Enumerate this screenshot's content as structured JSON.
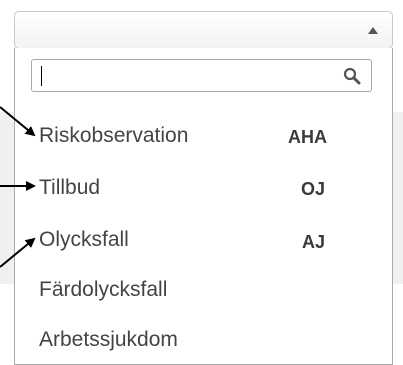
{
  "search": {
    "value": "",
    "placeholder": ""
  },
  "icons": {
    "dropdown_arrow": "triangle-up-icon",
    "search": "search-icon",
    "annotation_arrow": "arrow-icon"
  },
  "options": [
    {
      "label": "Riskobservation",
      "code": "AHA"
    },
    {
      "label": "Tillbud",
      "code": "OJ"
    },
    {
      "label": "Olycksfall",
      "code": "AJ"
    },
    {
      "label": "Färdolycksfall",
      "code": ""
    },
    {
      "label": "Arbetssjukdom",
      "code": ""
    }
  ]
}
